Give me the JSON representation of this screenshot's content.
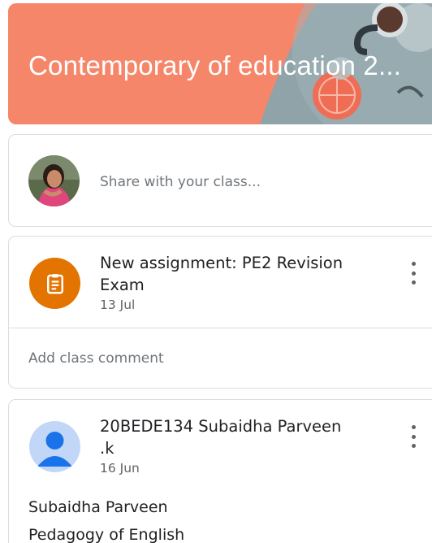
{
  "class": {
    "title": "Contemporary of education 2...",
    "banner_color": "#f6866a"
  },
  "share": {
    "placeholder": "Share with your class..."
  },
  "stream": [
    {
      "type": "assignment",
      "icon": "assignment-icon",
      "title": "New assignment: PE2 Revision Exam",
      "date": "13 Jul",
      "comment_placeholder": "Add class comment",
      "icon_color": "#e37400"
    },
    {
      "type": "post",
      "icon": "person-icon",
      "author": "20BEDE134 Subaidha Parveen .k",
      "date": "16 Jun",
      "body_lines": [
        "Subaidha Parveen",
        "Pedagogy of English"
      ]
    }
  ]
}
